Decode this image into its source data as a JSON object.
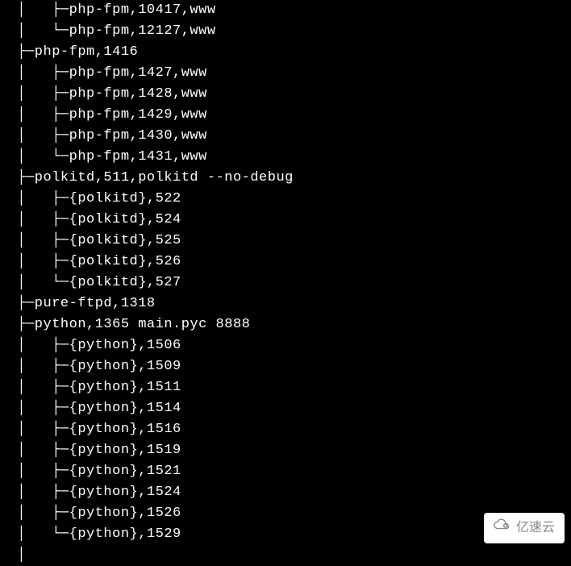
{
  "terminal": {
    "lines": [
      "  │   ├─php-fpm,10417,www",
      "  │   └─php-fpm,12127,www",
      "  ├─php-fpm,1416",
      "  │   ├─php-fpm,1427,www",
      "  │   ├─php-fpm,1428,www",
      "  │   ├─php-fpm,1429,www",
      "  │   ├─php-fpm,1430,www",
      "  │   └─php-fpm,1431,www",
      "  ├─polkitd,511,polkitd --no-debug",
      "  │   ├─{polkitd},522",
      "  │   ├─{polkitd},524",
      "  │   ├─{polkitd},525",
      "  │   ├─{polkitd},526",
      "  │   └─{polkitd},527",
      "  ├─pure-ftpd,1318",
      "  ├─python,1365 main.pyc 8888",
      "  │   ├─{python},1506",
      "  │   ├─{python},1509",
      "  │   ├─{python},1511",
      "  │   ├─{python},1514",
      "  │   ├─{python},1516",
      "  │   ├─{python},1519",
      "  │   ├─{python},1521",
      "  │   ├─{python},1524",
      "  │   ├─{python},1526",
      "  │   └─{python},1529",
      "  │"
    ]
  },
  "watermark": {
    "text": "亿速云"
  },
  "process_tree": {
    "nodes": [
      {
        "name": "php-fpm",
        "pid": 10417,
        "user": "www",
        "type": "child",
        "connector": "tee"
      },
      {
        "name": "php-fpm",
        "pid": 12127,
        "user": "www",
        "type": "child",
        "connector": "elbow"
      },
      {
        "name": "php-fpm",
        "pid": 1416,
        "type": "parent",
        "connector": "tee",
        "children": [
          {
            "name": "php-fpm",
            "pid": 1427,
            "user": "www",
            "connector": "tee"
          },
          {
            "name": "php-fpm",
            "pid": 1428,
            "user": "www",
            "connector": "tee"
          },
          {
            "name": "php-fpm",
            "pid": 1429,
            "user": "www",
            "connector": "tee"
          },
          {
            "name": "php-fpm",
            "pid": 1430,
            "user": "www",
            "connector": "tee"
          },
          {
            "name": "php-fpm",
            "pid": 1431,
            "user": "www",
            "connector": "elbow"
          }
        ]
      },
      {
        "name": "polkitd",
        "pid": 511,
        "user": "polkitd",
        "args": "--no-debug",
        "type": "parent",
        "connector": "tee",
        "children": [
          {
            "name": "{polkitd}",
            "pid": 522,
            "connector": "tee"
          },
          {
            "name": "{polkitd}",
            "pid": 524,
            "connector": "tee"
          },
          {
            "name": "{polkitd}",
            "pid": 525,
            "connector": "tee"
          },
          {
            "name": "{polkitd}",
            "pid": 526,
            "connector": "tee"
          },
          {
            "name": "{polkitd}",
            "pid": 527,
            "connector": "elbow"
          }
        ]
      },
      {
        "name": "pure-ftpd",
        "pid": 1318,
        "type": "parent",
        "connector": "tee"
      },
      {
        "name": "python",
        "pid": 1365,
        "args": "main.pyc 8888",
        "type": "parent",
        "connector": "tee",
        "children": [
          {
            "name": "{python}",
            "pid": 1506,
            "connector": "tee"
          },
          {
            "name": "{python}",
            "pid": 1509,
            "connector": "tee"
          },
          {
            "name": "{python}",
            "pid": 1511,
            "connector": "tee"
          },
          {
            "name": "{python}",
            "pid": 1514,
            "connector": "tee"
          },
          {
            "name": "{python}",
            "pid": 1516,
            "connector": "tee"
          },
          {
            "name": "{python}",
            "pid": 1519,
            "connector": "tee"
          },
          {
            "name": "{python}",
            "pid": 1521,
            "connector": "tee"
          },
          {
            "name": "{python}",
            "pid": 1524,
            "connector": "tee"
          },
          {
            "name": "{python}",
            "pid": 1526,
            "connector": "tee"
          },
          {
            "name": "{python}",
            "pid": 1529,
            "connector": "elbow"
          }
        ]
      }
    ]
  }
}
